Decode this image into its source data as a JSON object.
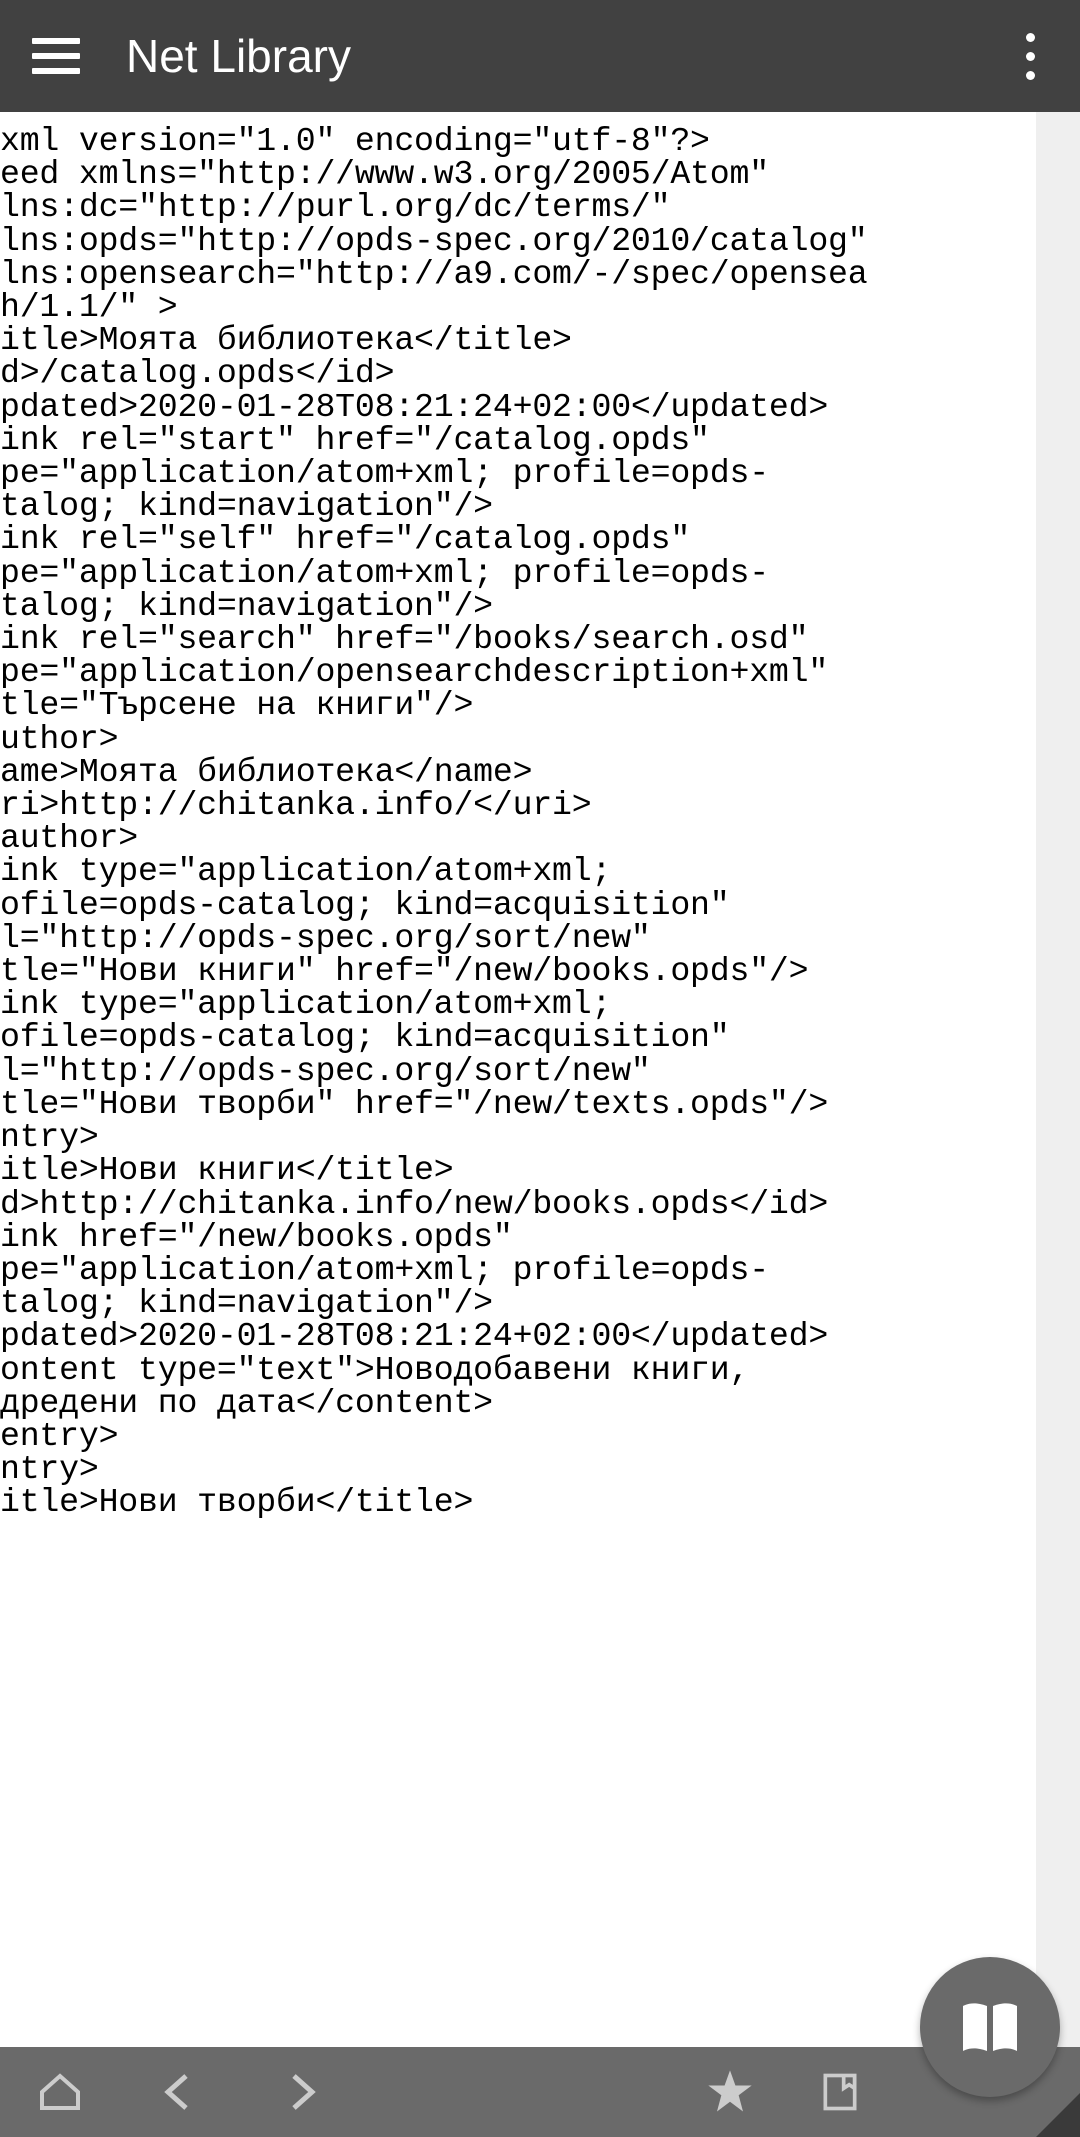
{
  "header": {
    "title": "Net Library"
  },
  "xml_content": "xml version=\"1.0\" encoding=\"utf-8\"?>\need xmlns=\"http://www.w3.org/2005/Atom\"\nlns:dc=\"http://purl.org/dc/terms/\"\nlns:opds=\"http://opds-spec.org/2010/catalog\"\nlns:opensearch=\"http://a9.com/-/spec/opensea\nh/1.1/\" >\nitle>Моята библиотека</title>\nd>/catalog.opds</id>\npdated>2020-01-28T08:21:24+02:00</updated>\nink rel=\"start\" href=\"/catalog.opds\"\npe=\"application/atom+xml; profile=opds-\ntalog; kind=navigation\"/>\nink rel=\"self\" href=\"/catalog.opds\"\npe=\"application/atom+xml; profile=opds-\ntalog; kind=navigation\"/>\nink rel=\"search\" href=\"/books/search.osd\"\npe=\"application/opensearchdescription+xml\"\ntle=\"Търсене на книги\"/>\nuthor>\name>Моята библиотека</name>\nri>http://chitanka.info/</uri>\nauthor>\nink type=\"application/atom+xml;\nofile=opds-catalog; kind=acquisition\"\nl=\"http://opds-spec.org/sort/new\"\ntle=\"Нови книги\" href=\"/new/books.opds\"/>\nink type=\"application/atom+xml;\nofile=opds-catalog; kind=acquisition\"\nl=\"http://opds-spec.org/sort/new\"\ntle=\"Нови творби\" href=\"/new/texts.opds\"/>\nntry>\nitle>Нови книги</title>\nd>http://chitanka.info/new/books.opds</id>\nink href=\"/new/books.opds\"\npe=\"application/atom+xml; profile=opds-\ntalog; kind=navigation\"/>\npdated>2020-01-28T08:21:24+02:00</updated>\nontent type=\"text\">Новодобавени книги,\nдредени по дата</content>\nentry>\nntry>\nitle>Нови творби</title>"
}
